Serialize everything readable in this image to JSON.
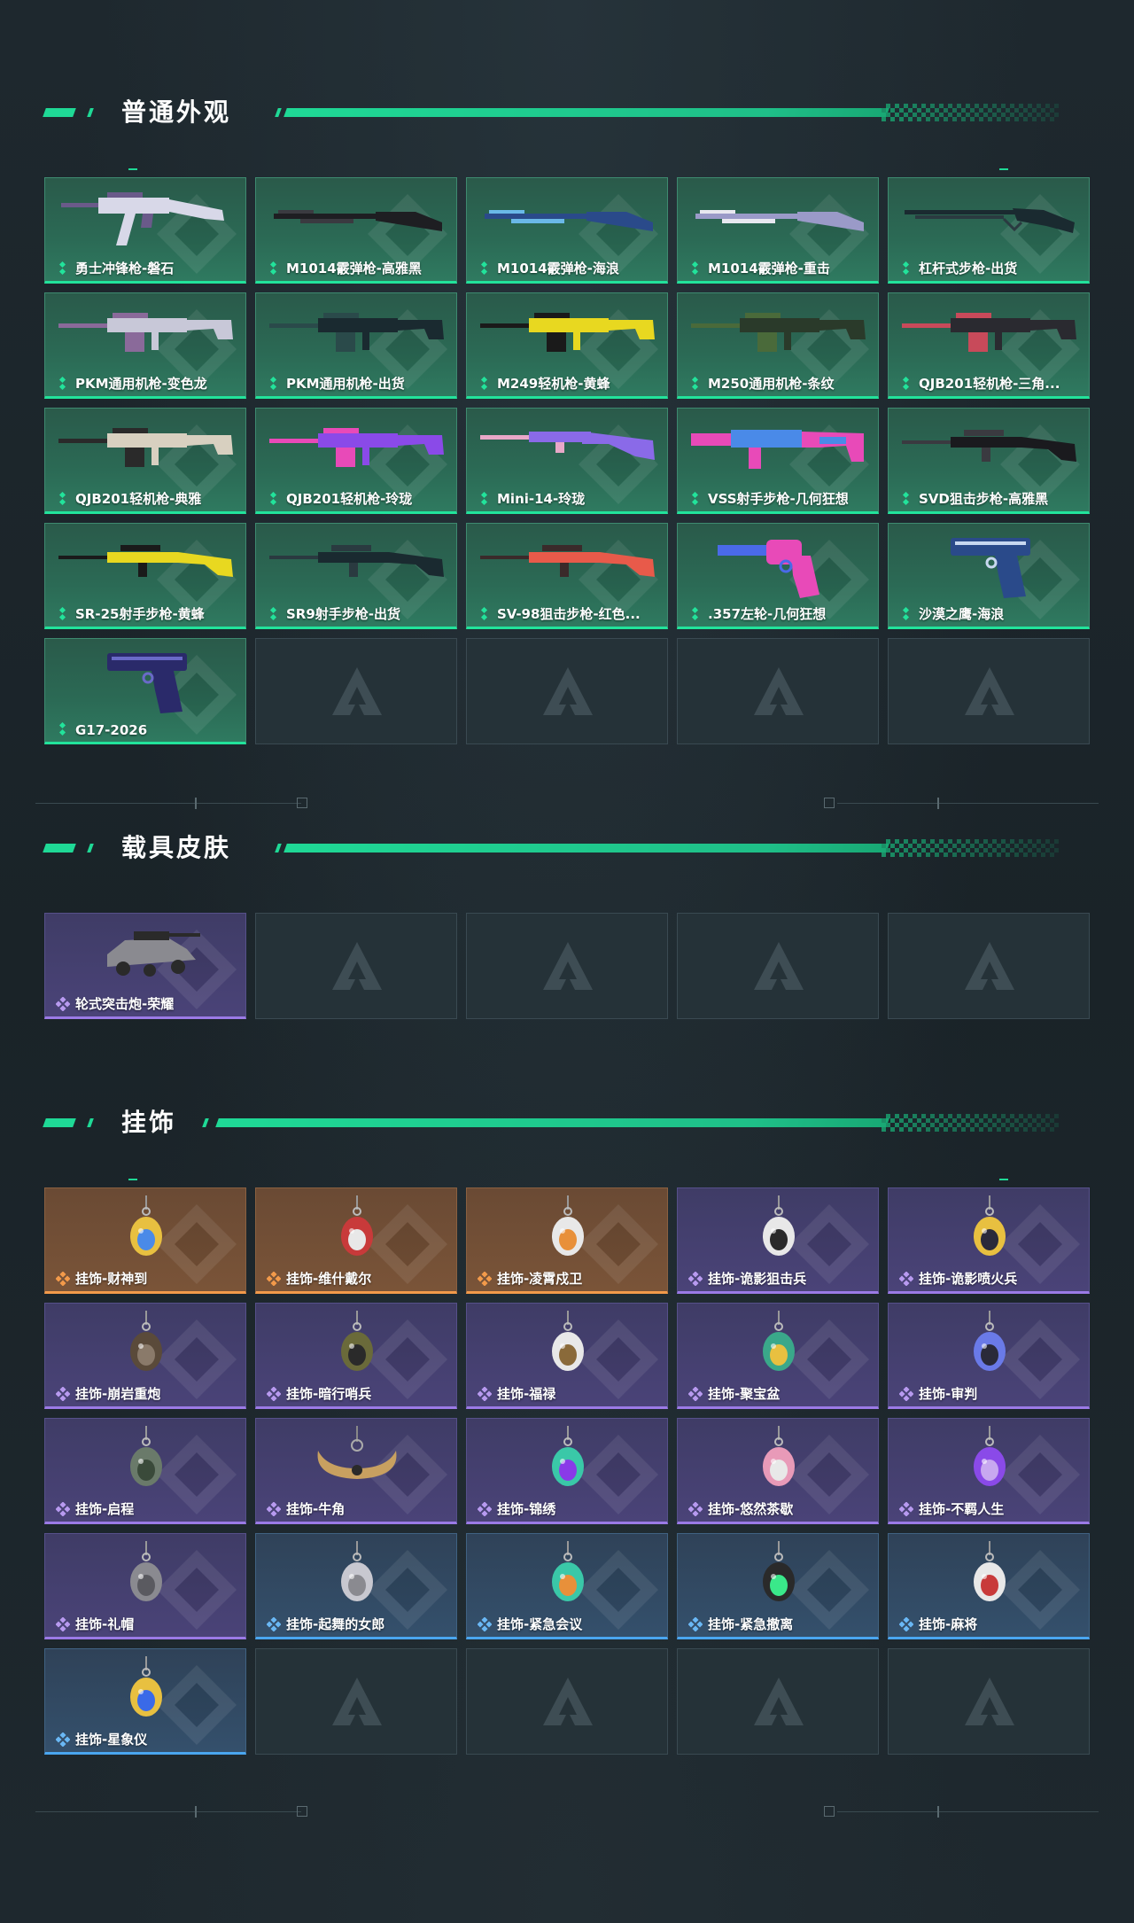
{
  "sections": {
    "weapons": {
      "title": "普通外观",
      "items": [
        {
          "label": "勇士冲锋枪-磐石",
          "rarity": "green",
          "art": "rifle",
          "c1": "#d8d8e8",
          "c2": "#6a5a8a"
        },
        {
          "label": "M1014霰弹枪-高雅黑",
          "rarity": "green",
          "art": "shotgun",
          "c1": "#1e1e22",
          "c2": "#3a3a40"
        },
        {
          "label": "M1014霰弹枪-海浪",
          "rarity": "green",
          "art": "shotgun",
          "c1": "#2a4a8a",
          "c2": "#6ab8e8"
        },
        {
          "label": "M1014霰弹枪-重击",
          "rarity": "green",
          "art": "shotgun",
          "c1": "#9a9ac8",
          "c2": "#e8e8f0"
        },
        {
          "label": "杠杆式步枪-出货",
          "rarity": "green",
          "art": "lever",
          "c1": "#1a2a30",
          "c2": "#2a3a40"
        },
        {
          "label": "PKM通用机枪-变色龙",
          "rarity": "green",
          "art": "mg",
          "c1": "#c8c8d8",
          "c2": "#8a6a9a"
        },
        {
          "label": "PKM通用机枪-出货",
          "rarity": "green",
          "art": "mg",
          "c1": "#1a2a30",
          "c2": "#2a4a4a"
        },
        {
          "label": "M249轻机枪-黄蜂",
          "rarity": "green",
          "art": "mg",
          "c1": "#e8d820",
          "c2": "#1a1a1a"
        },
        {
          "label": "M250通用机枪-条纹",
          "rarity": "green",
          "art": "mg",
          "c1": "#2a3a2a",
          "c2": "#4a6a3a"
        },
        {
          "label": "QJB201轻机枪-三角...",
          "rarity": "green",
          "art": "mg",
          "c1": "#2a2a30",
          "c2": "#c84a5a"
        },
        {
          "label": "QJB201轻机枪-典雅",
          "rarity": "green",
          "art": "mg",
          "c1": "#d8d0c0",
          "c2": "#2a2a2a"
        },
        {
          "label": "QJB201轻机枪-玲珑",
          "rarity": "green",
          "art": "mg",
          "c1": "#8a4ae8",
          "c2": "#e84ab8"
        },
        {
          "label": "Mini-14-玲珑",
          "rarity": "green",
          "art": "rifle2",
          "c1": "#8a6ae8",
          "c2": "#e8a8c8"
        },
        {
          "label": "VSS射手步枪-几何狂想",
          "rarity": "green",
          "art": "vss",
          "c1": "#e84ab8",
          "c2": "#4a8ae8"
        },
        {
          "label": "SVD狙击步枪-高雅黑",
          "rarity": "green",
          "art": "sniper",
          "c1": "#1a1a1e",
          "c2": "#3a3a40"
        },
        {
          "label": "SR-25射手步枪-黄蜂",
          "rarity": "green",
          "art": "sniper",
          "c1": "#e8d820",
          "c2": "#1a1a1a"
        },
        {
          "label": "SR9射手步枪-出货",
          "rarity": "green",
          "art": "sniper",
          "c1": "#1a2a30",
          "c2": "#2a3a40"
        },
        {
          "label": "SV-98狙击步枪-红色...",
          "rarity": "green",
          "art": "sniper",
          "c1": "#e85a4a",
          "c2": "#3a2a2a"
        },
        {
          "label": ".357左轮-几何狂想",
          "rarity": "green",
          "art": "revolver",
          "c1": "#e84ab8",
          "c2": "#4a6ae8"
        },
        {
          "label": "沙漠之鹰-海浪",
          "rarity": "green",
          "art": "pistol",
          "c1": "#2a4a8a",
          "c2": "#c8d8f0"
        },
        {
          "label": "G17-2026",
          "rarity": "green",
          "art": "pistol",
          "c1": "#2a2a6a",
          "c2": "#6a6ac8"
        },
        {
          "label": "",
          "rarity": "empty"
        },
        {
          "label": "",
          "rarity": "empty"
        },
        {
          "label": "",
          "rarity": "empty"
        },
        {
          "label": "",
          "rarity": "empty"
        }
      ]
    },
    "vehicles": {
      "title": "载具皮肤",
      "items": [
        {
          "label": "轮式突击炮-荣耀",
          "rarity": "purple",
          "art": "vehicle",
          "c1": "#8a8a90",
          "c2": "#2a2a2a"
        },
        {
          "label": "",
          "rarity": "empty"
        },
        {
          "label": "",
          "rarity": "empty"
        },
        {
          "label": "",
          "rarity": "empty"
        },
        {
          "label": "",
          "rarity": "empty"
        }
      ]
    },
    "charms": {
      "title": "挂饰",
      "items": [
        {
          "label": "挂饰-财神到",
          "rarity": "orange",
          "art": "charm",
          "c1": "#e8c040",
          "c2": "#4a8ae8"
        },
        {
          "label": "挂饰-维什戴尔",
          "rarity": "orange",
          "art": "charm",
          "c1": "#c83a3a",
          "c2": "#e8e8e8"
        },
        {
          "label": "挂饰-凌霄戍卫",
          "rarity": "orange",
          "art": "charm",
          "c1": "#e8e8e8",
          "c2": "#e8903a"
        },
        {
          "label": "挂饰-诡影狙击兵",
          "rarity": "purple",
          "art": "charm",
          "c1": "#e8e8e8",
          "c2": "#2a2a2a"
        },
        {
          "label": "挂饰-诡影喷火兵",
          "rarity": "purple",
          "art": "charm",
          "c1": "#e8c040",
          "c2": "#2a2a3a"
        },
        {
          "label": "挂饰-崩岩重炮",
          "rarity": "purple",
          "art": "charm",
          "c1": "#5a4a3a",
          "c2": "#8a7a6a"
        },
        {
          "label": "挂饰-暗行哨兵",
          "rarity": "purple",
          "art": "charm",
          "c1": "#6a6a3a",
          "c2": "#2a2a2a"
        },
        {
          "label": "挂饰-福禄",
          "rarity": "purple",
          "art": "charm",
          "c1": "#e8e8e8",
          "c2": "#8a6a3a"
        },
        {
          "label": "挂饰-聚宝盆",
          "rarity": "purple",
          "art": "charm",
          "c1": "#3aa88a",
          "c2": "#e8c040"
        },
        {
          "label": "挂饰-审判",
          "rarity": "purple",
          "art": "charm",
          "c1": "#6a7ae8",
          "c2": "#2a2a3a"
        },
        {
          "label": "挂饰-启程",
          "rarity": "purple",
          "art": "charm",
          "c1": "#6a7a6a",
          "c2": "#3a4a3a"
        },
        {
          "label": "挂饰-牛角",
          "rarity": "purple",
          "art": "horn",
          "c1": "#c8a060",
          "c2": "#2a2a2a"
        },
        {
          "label": "挂饰-锦绣",
          "rarity": "purple",
          "art": "charm",
          "c1": "#3ac8a8",
          "c2": "#8a3ae8"
        },
        {
          "label": "挂饰-悠然茶歇",
          "rarity": "purple",
          "art": "charm",
          "c1": "#e89ab8",
          "c2": "#e8e8e8"
        },
        {
          "label": "挂饰-不羁人生",
          "rarity": "purple",
          "art": "charm",
          "c1": "#8a4ae8",
          "c2": "#c8a8f0"
        },
        {
          "label": "挂饰-礼帽",
          "rarity": "purple",
          "art": "charm",
          "c1": "#8a8a90",
          "c2": "#5a5a60"
        },
        {
          "label": "挂饰-起舞的女郎",
          "rarity": "blue",
          "art": "charm",
          "c1": "#c8c8d0",
          "c2": "#8a8a90"
        },
        {
          "label": "挂饰-紧急会议",
          "rarity": "blue",
          "art": "charm",
          "c1": "#3ac8a8",
          "c2": "#e8903a"
        },
        {
          "label": "挂饰-紧急撤离",
          "rarity": "blue",
          "art": "charm",
          "c1": "#2a2a2a",
          "c2": "#3ae88a"
        },
        {
          "label": "挂饰-麻将",
          "rarity": "blue",
          "art": "charm",
          "c1": "#e8e8e8",
          "c2": "#c83a3a"
        },
        {
          "label": "挂饰-星象仪",
          "rarity": "blue",
          "art": "charm",
          "c1": "#e8c040",
          "c2": "#3a6ae8"
        },
        {
          "label": "",
          "rarity": "empty"
        },
        {
          "label": "",
          "rarity": "empty"
        },
        {
          "label": "",
          "rarity": "empty"
        },
        {
          "label": "",
          "rarity": "empty"
        }
      ]
    }
  },
  "colors": {
    "accent": "#1fd996",
    "green": "#22e39b",
    "purple": "#9b7ae6",
    "orange": "#f39a4a",
    "blue": "#4aa6f0"
  }
}
